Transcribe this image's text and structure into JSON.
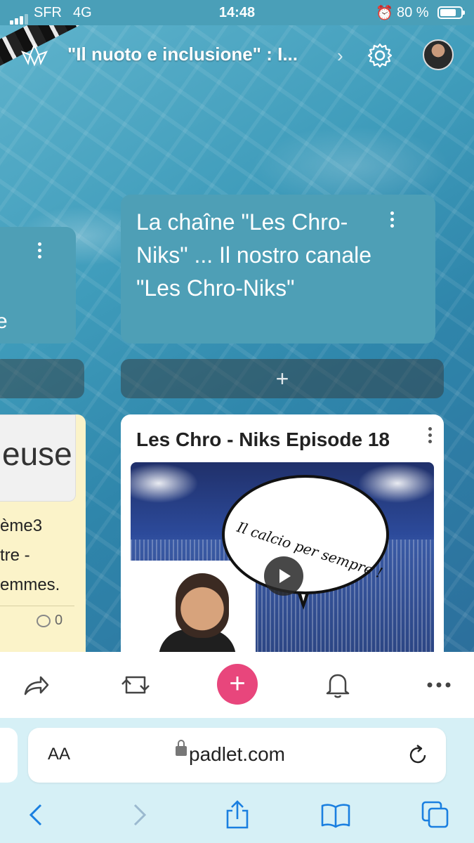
{
  "status_bar": {
    "carrier": "SFR",
    "network": "4G",
    "time": "14:48",
    "battery_percent": "80 %",
    "battery_level": 0.8,
    "icons": [
      "signal-icon",
      "alarm-icon",
      "battery-icon"
    ]
  },
  "header": {
    "logo_icon": "padlet-logo-icon",
    "title": "\"Il nuoto e inclusione\" : I...",
    "chevron": "›",
    "settings_icon": "gear-icon",
    "avatar_icon": "avatar"
  },
  "columns": {
    "left": {
      "visible_fragment": "e"
    },
    "right": {
      "title": "La chaîne \"Les Chro-Niks\" ... Il nostro canale \"Les Chro-Niks\"",
      "add_label": "+"
    }
  },
  "posts": {
    "left": {
      "image_text": "euse",
      "lines": [
        "ème3",
        "tre -",
        "emmes."
      ],
      "comment_count": "0"
    },
    "right": {
      "title": "Les Chro - Niks Episode 18",
      "thumbnail_caption": "Il calcio per sempre !"
    }
  },
  "toolbar": {
    "items": [
      "share-icon",
      "remake-icon",
      "add-post-button",
      "bell-icon",
      "more-icon"
    ],
    "add_label": "+"
  },
  "safari": {
    "aa_label": "AA",
    "domain": "padlet.com"
  },
  "colors": {
    "column_header": "#4e9fb6",
    "add_button": "#e8467c",
    "safari_bg": "#d6f0f6",
    "ios_blue": "#1a7fe0"
  }
}
